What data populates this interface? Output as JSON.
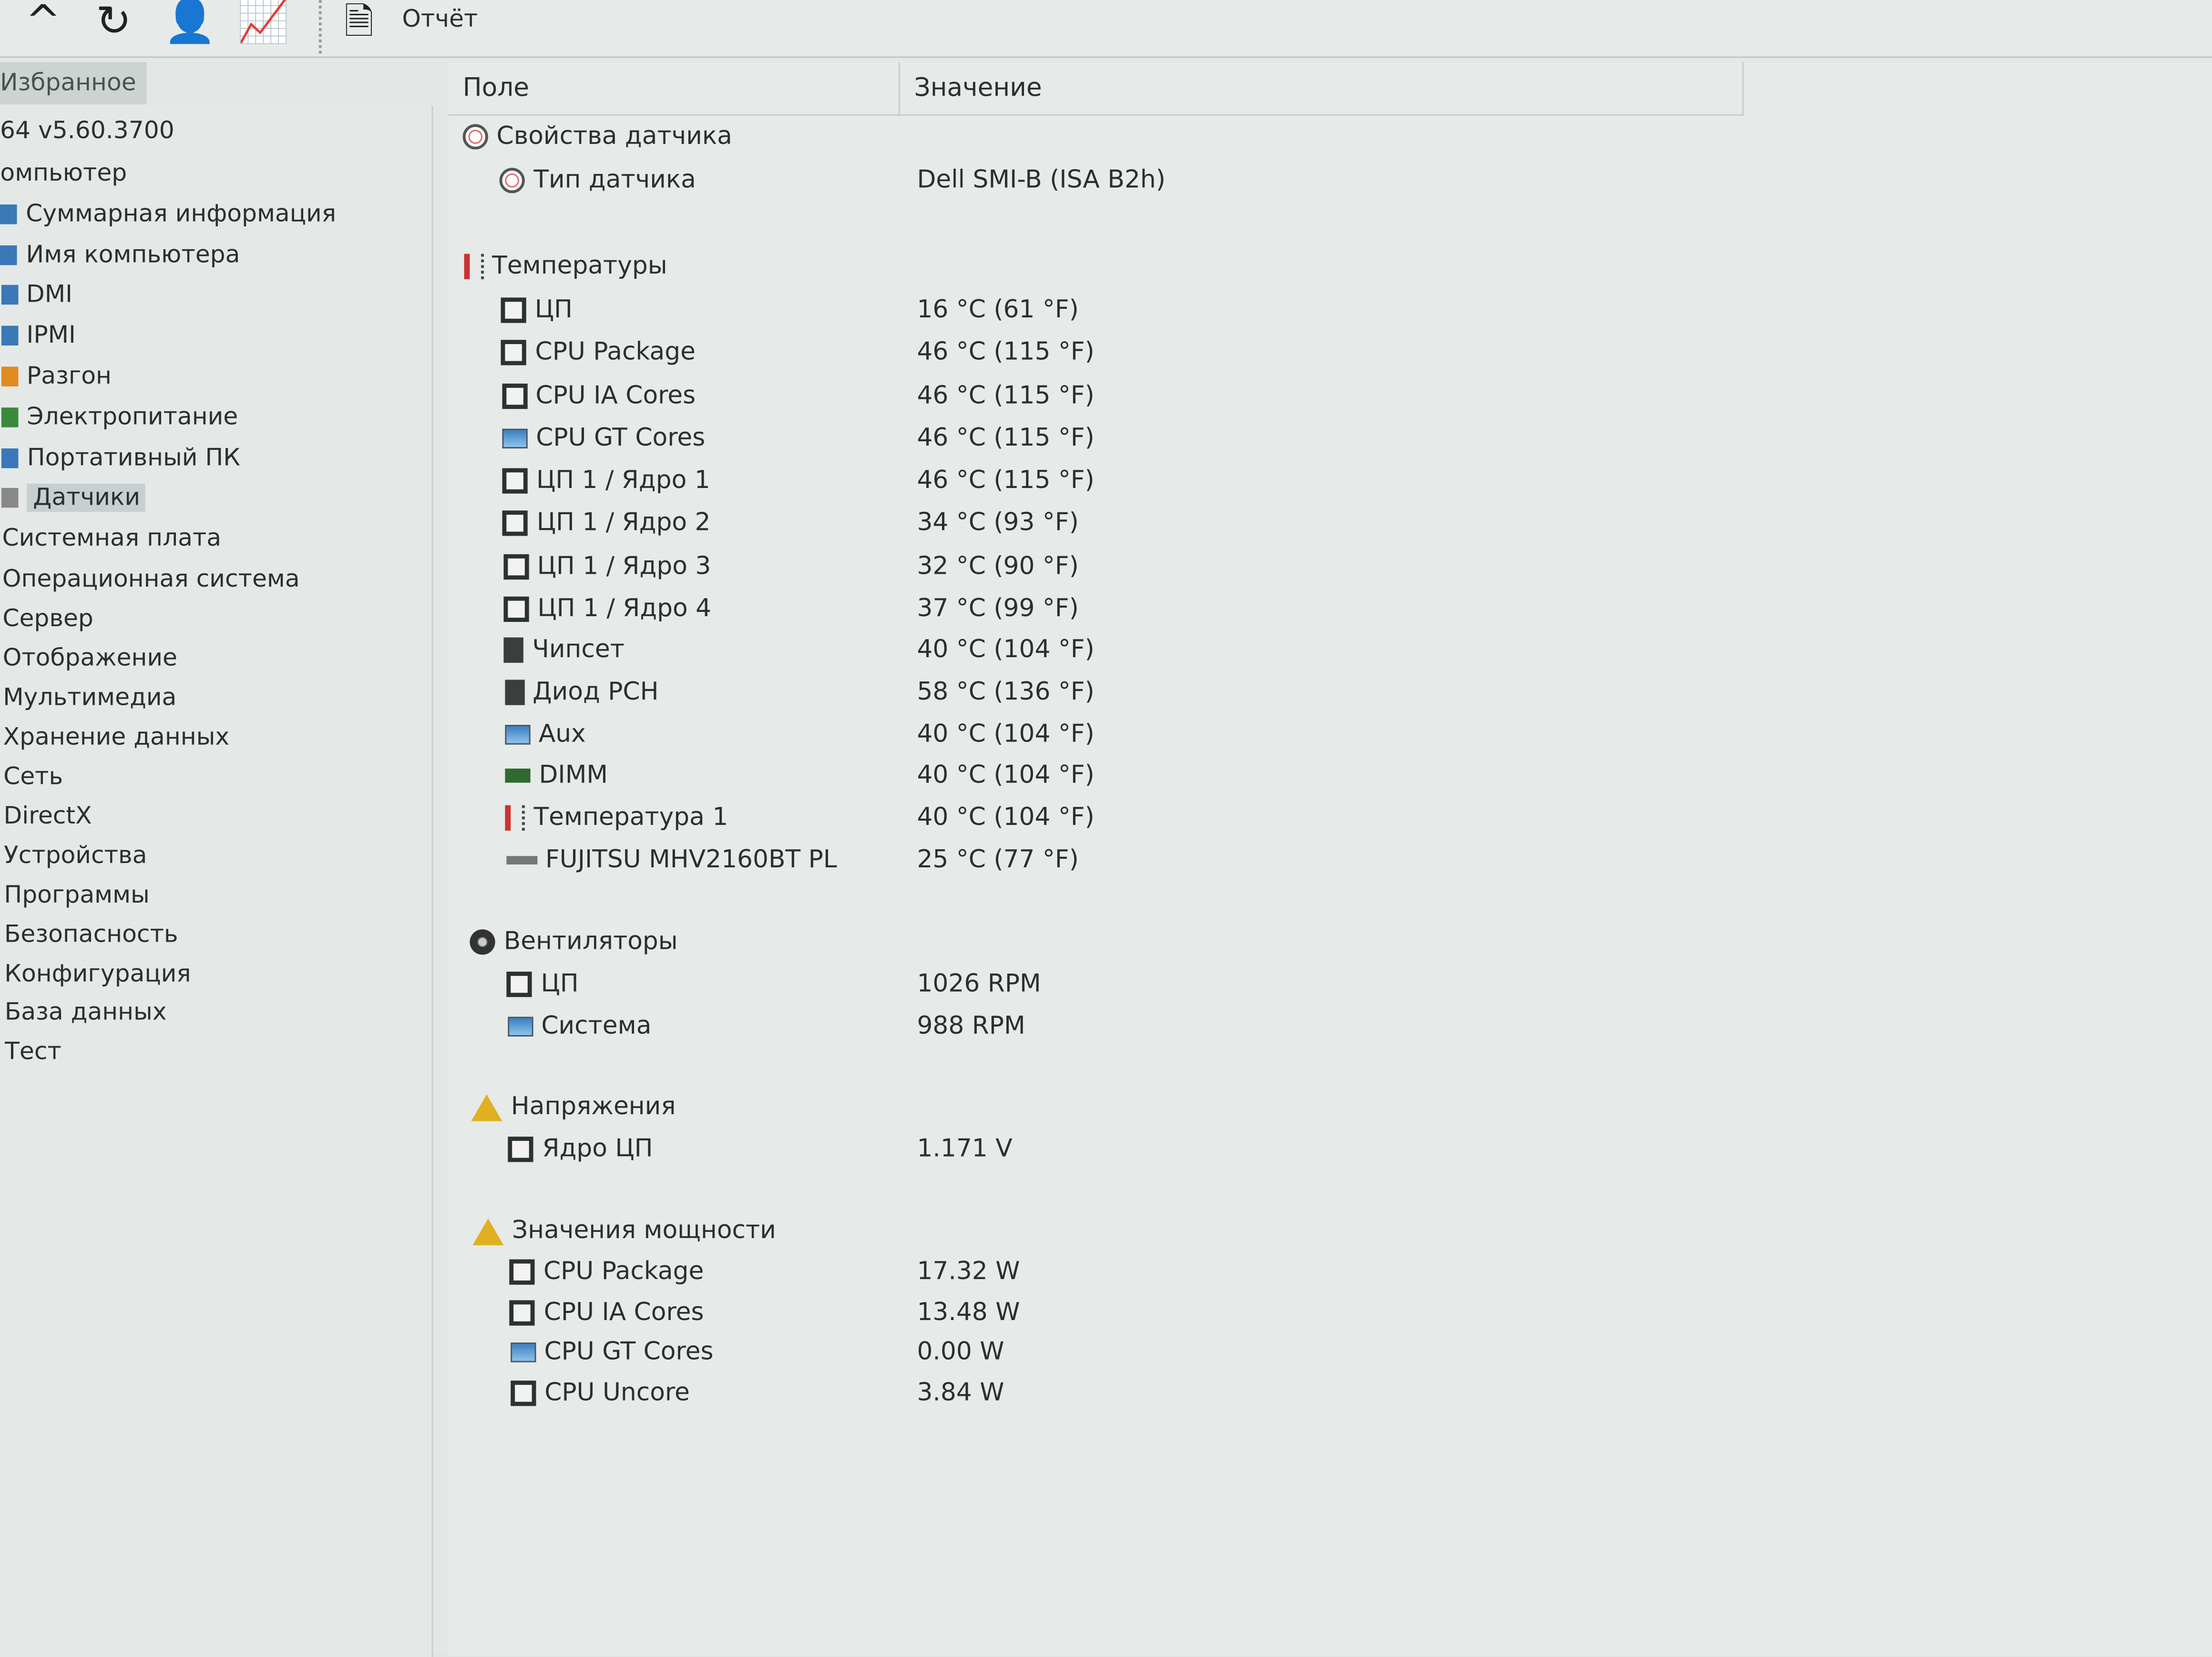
{
  "toolbar": {
    "icons": [
      "up-arrow-icon",
      "refresh-icon",
      "users-icon",
      "chart-icon",
      "report-icon"
    ],
    "report_label": "Отчёт"
  },
  "sidebar": {
    "favorites_tab": "Избранное",
    "items": [
      {
        "label": "64 v5.60.3700"
      },
      {
        "label": "омпьютер"
      },
      {
        "label": "Суммарная информация",
        "icon": "monitor-icon"
      },
      {
        "label": "Имя компьютера",
        "icon": "monitor-icon"
      },
      {
        "label": "DMI",
        "icon": "monitor-icon"
      },
      {
        "label": "IPMI",
        "icon": "monitor-icon"
      },
      {
        "label": "Разгон",
        "icon": "fire-icon"
      },
      {
        "label": "Электропитание",
        "icon": "power-icon"
      },
      {
        "label": "Портативный ПК",
        "icon": "laptop-icon"
      },
      {
        "label": "Датчики",
        "icon": "sensor-icon",
        "selected": true
      },
      {
        "label": "Системная плата"
      },
      {
        "label": "Операционная система"
      },
      {
        "label": "Сервер"
      },
      {
        "label": "Отображение"
      },
      {
        "label": "Мультимедиа"
      },
      {
        "label": "Хранение данных"
      },
      {
        "label": "Сеть"
      },
      {
        "label": "DirectX"
      },
      {
        "label": "Устройства"
      },
      {
        "label": "Программы"
      },
      {
        "label": "Безопасность"
      },
      {
        "label": "Конфигурация"
      },
      {
        "label": "База данных"
      },
      {
        "label": "Тест"
      }
    ]
  },
  "main": {
    "columns": {
      "field": "Поле",
      "value": "Значение"
    },
    "groups": [
      {
        "title": "Свойства датчика",
        "icon": "sensor",
        "rows": [
          {
            "field": "Тип датчика",
            "value": "Dell SMI-B  (ISA B2h)",
            "icon": "sensor"
          }
        ]
      },
      {
        "title": "Температуры",
        "icon": "therm",
        "rows": [
          {
            "field": "ЦП",
            "value": "16 °C  (61 °F)",
            "icon": "sq"
          },
          {
            "field": "CPU Package",
            "value": "46 °C  (115 °F)",
            "icon": "sq"
          },
          {
            "field": "CPU IA Cores",
            "value": "46 °C  (115 °F)",
            "icon": "sq"
          },
          {
            "field": "CPU GT Cores",
            "value": "46 °C  (115 °F)",
            "icon": "mon"
          },
          {
            "field": "ЦП 1 / Ядро 1",
            "value": "46 °C  (115 °F)",
            "icon": "sq"
          },
          {
            "field": "ЦП 1 / Ядро 2",
            "value": "34 °C  (93 °F)",
            "icon": "sq"
          },
          {
            "field": "ЦП 1 / Ядро 3",
            "value": "32 °C  (90 °F)",
            "icon": "sq"
          },
          {
            "field": "ЦП 1 / Ядро 4",
            "value": "37 °C  (99 °F)",
            "icon": "sq"
          },
          {
            "field": "Чипсет",
            "value": "40 °C  (104 °F)",
            "icon": "chip"
          },
          {
            "field": "Диод PCH",
            "value": "58 °C  (136 °F)",
            "icon": "chip"
          },
          {
            "field": "Aux",
            "value": "40 °C  (104 °F)",
            "icon": "mon"
          },
          {
            "field": "DIMM",
            "value": "40 °C  (104 °F)",
            "icon": "dimm"
          },
          {
            "field": "Температура 1",
            "value": "40 °C  (104 °F)",
            "icon": "therm"
          },
          {
            "field": "FUJITSU MHV2160BT PL",
            "value": "25 °C  (77 °F)",
            "icon": "hdd"
          }
        ]
      },
      {
        "title": "Вентиляторы",
        "icon": "fan",
        "rows": [
          {
            "field": "ЦП",
            "value": "1026 RPM",
            "icon": "sq"
          },
          {
            "field": "Система",
            "value": "988 RPM",
            "icon": "mon"
          }
        ]
      },
      {
        "title": "Напряжения",
        "icon": "warn",
        "rows": [
          {
            "field": "Ядро ЦП",
            "value": "1.171 V",
            "icon": "sq"
          }
        ]
      },
      {
        "title": "Значения мощности",
        "icon": "warn",
        "rows": [
          {
            "field": "CPU Package",
            "value": "17.32 W",
            "icon": "sq"
          },
          {
            "field": "CPU IA Cores",
            "value": "13.48 W",
            "icon": "sq"
          },
          {
            "field": "CPU GT Cores",
            "value": "0.00 W",
            "icon": "mon"
          },
          {
            "field": "CPU Uncore",
            "value": "3.84 W",
            "icon": "sq"
          }
        ]
      }
    ]
  }
}
